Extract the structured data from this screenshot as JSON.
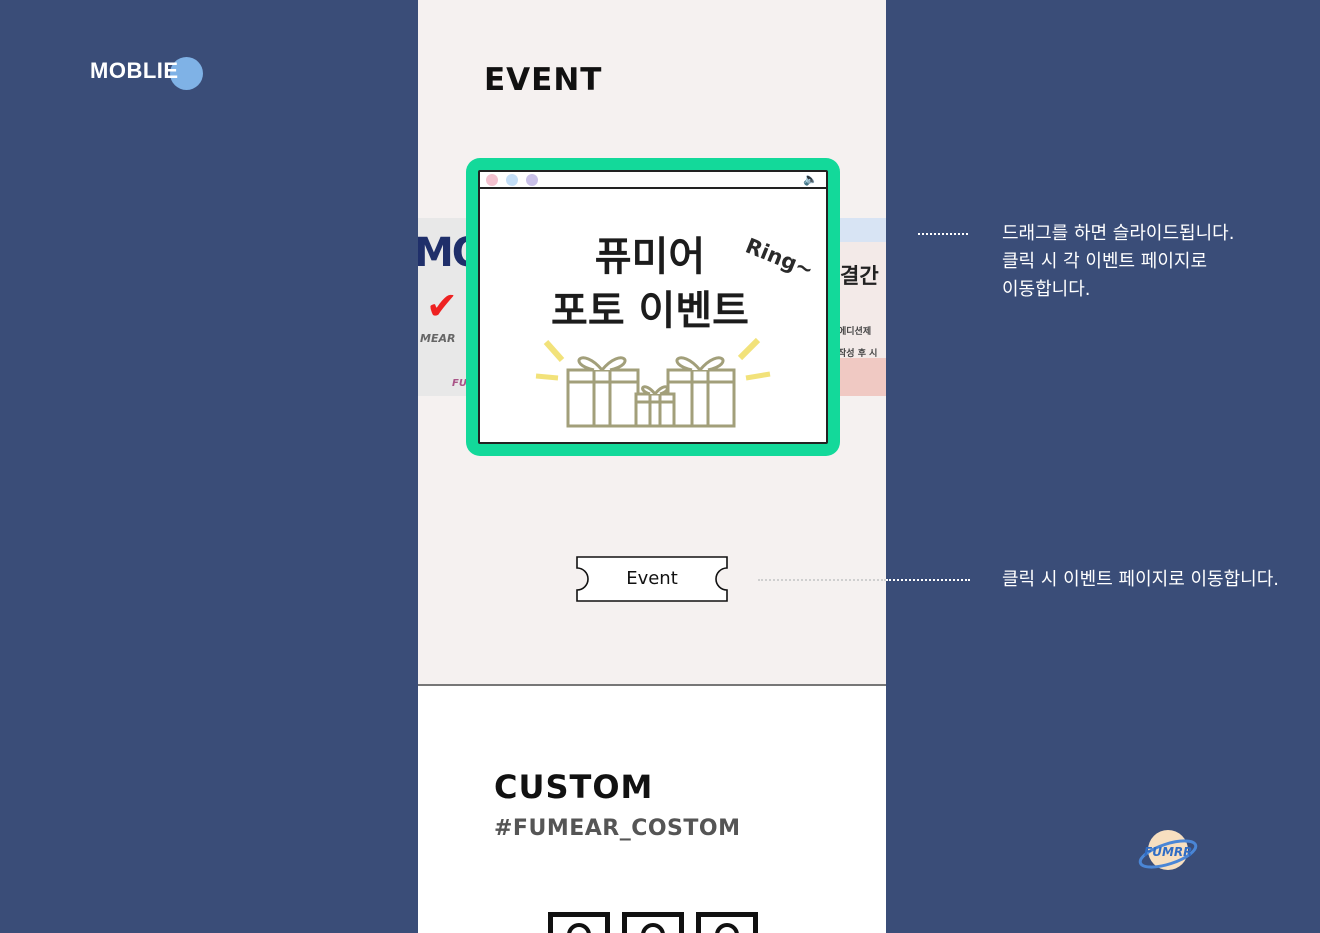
{
  "brand": {
    "label": "MOBLIE"
  },
  "colors": {
    "background": "#3a4d78",
    "phone_bg": "#f5f1f0",
    "slide_frame": "#13d99a",
    "brand_dot": "#7fb2e6"
  },
  "event_section": {
    "title": "EVENT",
    "slide": {
      "line1": "퓨미어",
      "line2": "포토 이벤트",
      "sticker": "Ring~"
    },
    "left_slide": {
      "big": "MO",
      "tiny": "MEAR",
      "tiny2": "FU"
    },
    "right_slide": {
      "title": "결간 ",
      "line1": "에디션제",
      "line2": "작성 후 시"
    },
    "button_label": "Event"
  },
  "custom_section": {
    "title": "CUSTOM",
    "tag": "#FUMEAR_COSTOM"
  },
  "annotations": {
    "slider_note": [
      "드래그를 하면 슬라이드됩니다.",
      "클릭 시 각 이벤트 페이지로",
      "이동합니다."
    ],
    "button_note": "클릭 시 이벤트 페이지로 이동합니다."
  },
  "logo": {
    "text": "FUMRR"
  }
}
